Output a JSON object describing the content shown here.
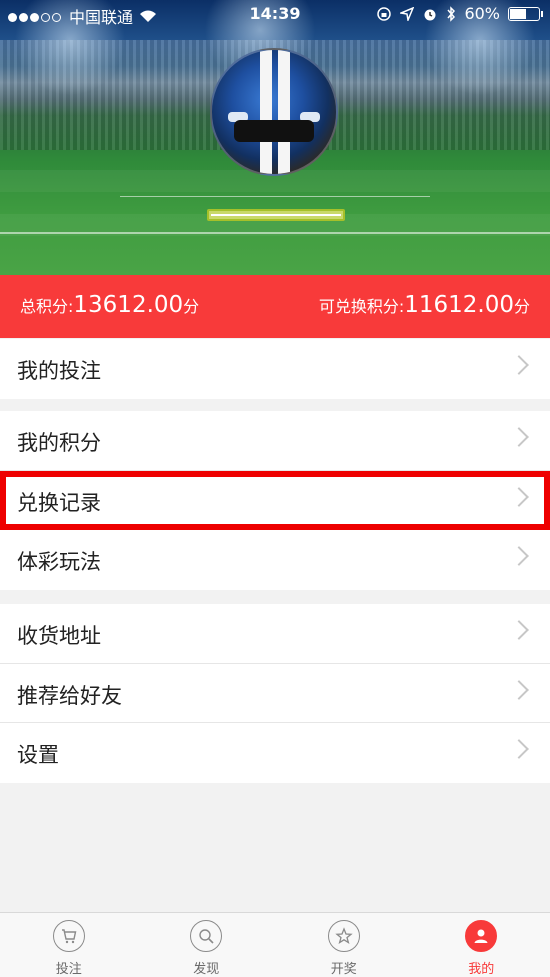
{
  "status_bar": {
    "carrier": "中国联通",
    "time": "14:39",
    "battery": "60%",
    "battery_level": 0.6
  },
  "profile": {
    "avatar": "car-avatar"
  },
  "points": {
    "total_label": "总积分:",
    "total_value": "13612.00",
    "total_unit": "分",
    "exchangeable_label": "可兑换积分:",
    "exchangeable_value": "11612.00",
    "exchangeable_unit": "分"
  },
  "menu": {
    "group1": [
      {
        "label": "我的投注"
      }
    ],
    "group2": [
      {
        "label": "我的积分"
      },
      {
        "label": "兑换记录"
      },
      {
        "label": "体彩玩法"
      }
    ],
    "group3": [
      {
        "label": "收货地址"
      },
      {
        "label": "推荐给好友"
      },
      {
        "label": "设置"
      }
    ]
  },
  "tabs": [
    {
      "label": "投注",
      "icon": "cart-icon",
      "active": false
    },
    {
      "label": "发现",
      "icon": "search-icon",
      "active": false
    },
    {
      "label": "开奖",
      "icon": "star-icon",
      "active": false
    },
    {
      "label": "我的",
      "icon": "user-icon",
      "active": true
    }
  ],
  "colors": {
    "accent": "#f83a3a",
    "highlight_box": "#ee0000"
  }
}
